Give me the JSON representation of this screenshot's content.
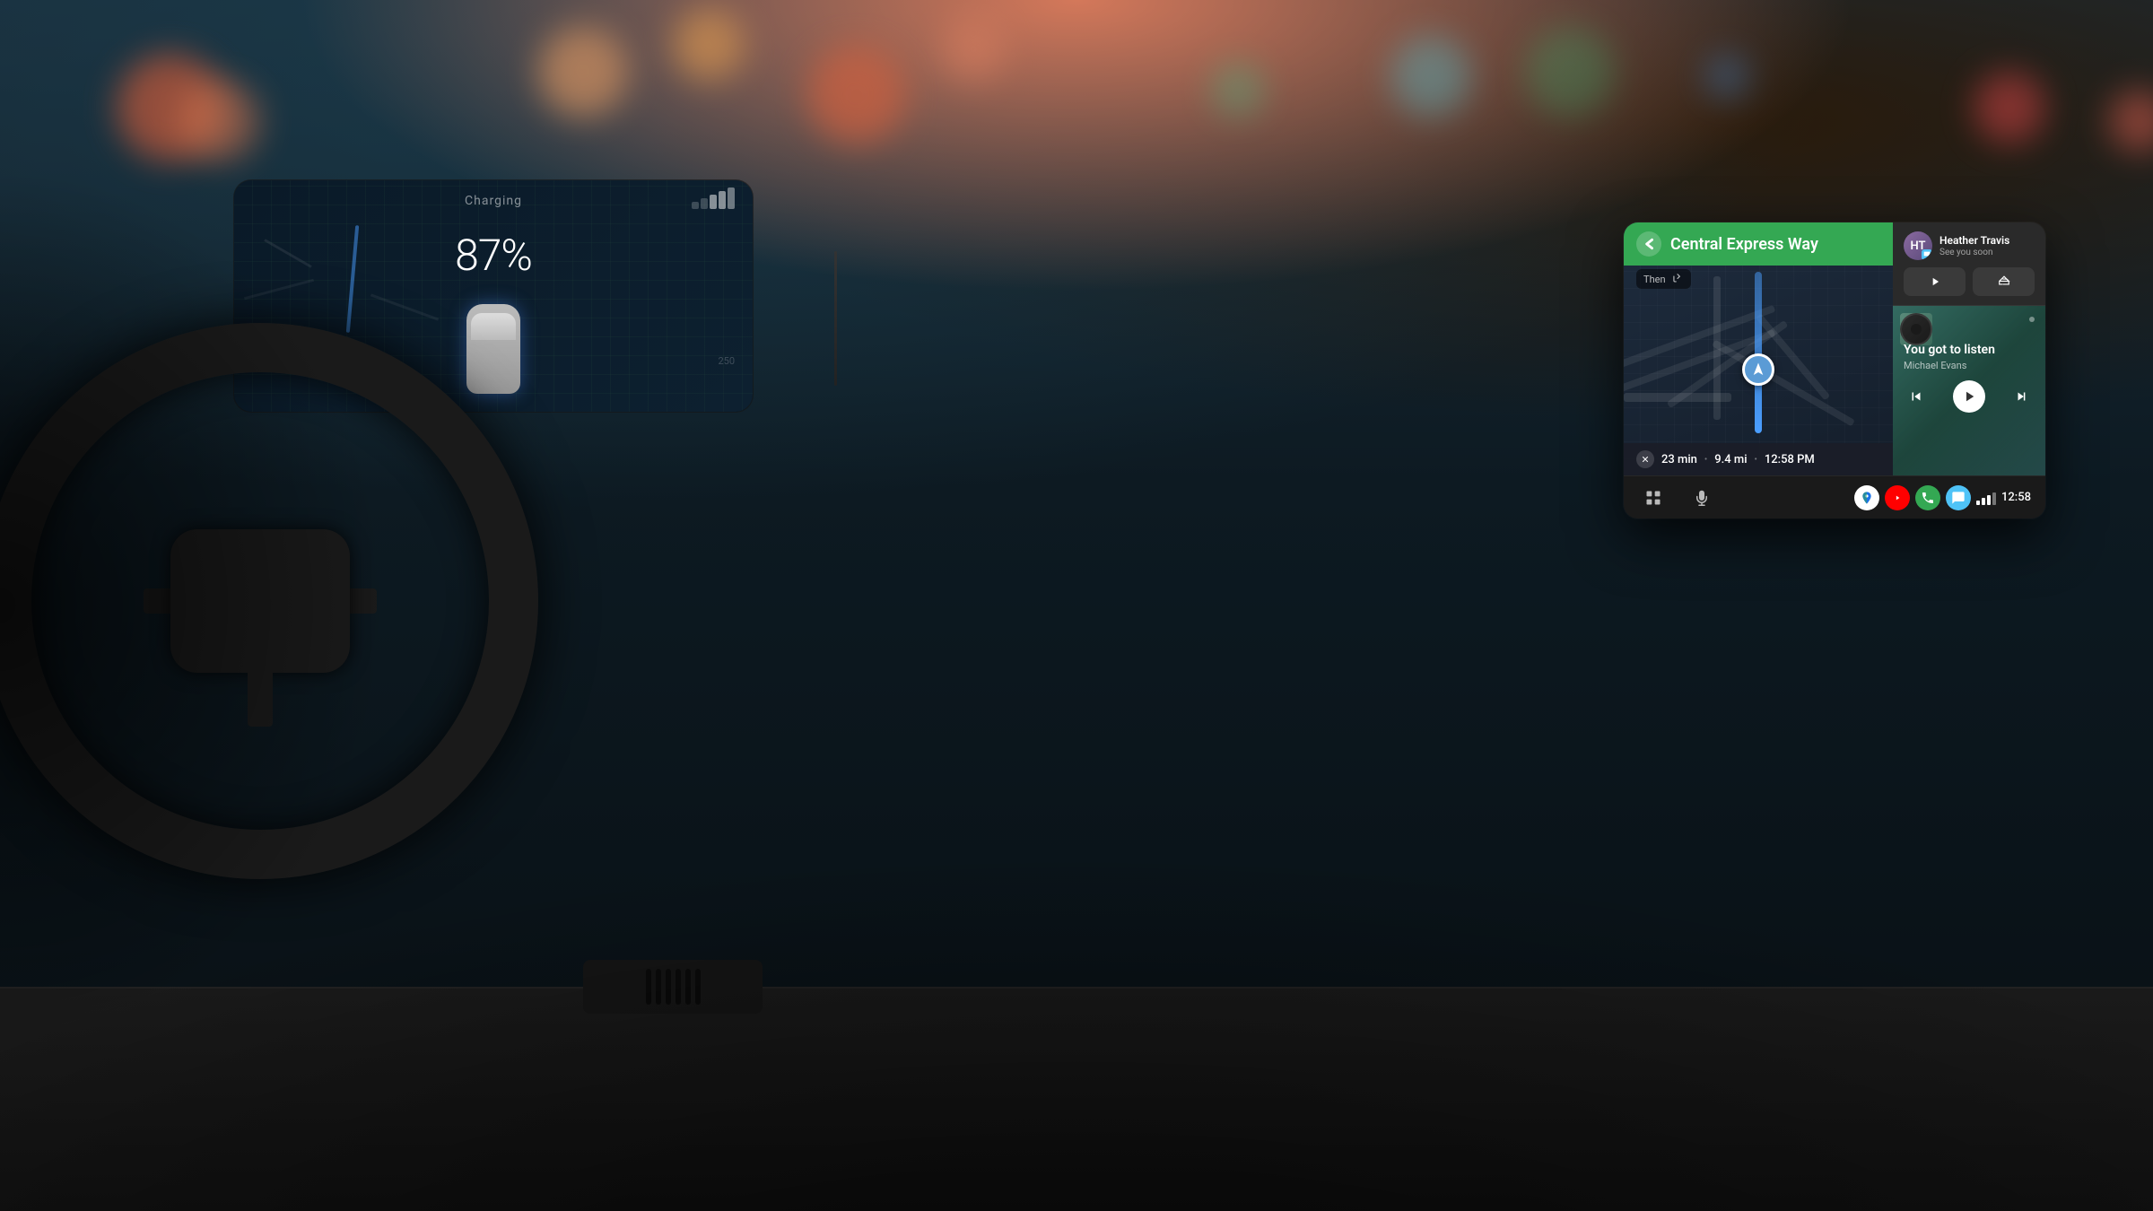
{
  "scene": {
    "bg_color": "#0d1520"
  },
  "dashboard": {
    "charging_label": "Charging",
    "battery_percent": "87%"
  },
  "android_auto": {
    "navigation": {
      "street": "Central Express Way",
      "then_label": "Then",
      "eta_minutes": "23 min",
      "eta_distance": "9.4 mi",
      "eta_time": "12:58 PM"
    },
    "message": {
      "contact_name": "Heather Travis",
      "contact_initials": "HT",
      "message_text": "See you soon",
      "play_label": "▶",
      "reply_label": "↩"
    },
    "music": {
      "title": "You got to listen",
      "artist": "Michael Evans",
      "prev_icon": "⏮",
      "play_icon": "▶",
      "next_icon": "⏭"
    },
    "taskbar": {
      "grid_icon": "⠿",
      "mic_icon": "🎤",
      "maps_label": "M",
      "youtube_label": "Y",
      "phone_label": "P",
      "messages_label": "✉",
      "time": "12:58"
    }
  }
}
